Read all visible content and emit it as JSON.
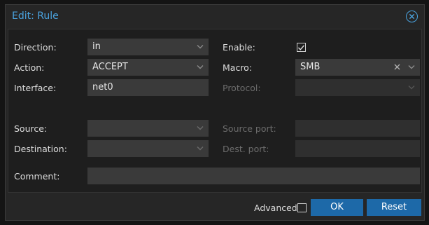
{
  "dialog": {
    "title": "Edit: Rule",
    "close_icon": "close-circle-icon"
  },
  "form": {
    "direction": {
      "label": "Direction:",
      "value": "in"
    },
    "action": {
      "label": "Action:",
      "value": "ACCEPT"
    },
    "interface": {
      "label": "Interface:",
      "value": "net0"
    },
    "enable": {
      "label": "Enable:",
      "checked": true
    },
    "macro": {
      "label": "Macro:",
      "value": "SMB"
    },
    "protocol": {
      "label": "Protocol:",
      "value": ""
    },
    "source": {
      "label": "Source:",
      "value": ""
    },
    "destination": {
      "label": "Destination:",
      "value": ""
    },
    "source_port": {
      "label": "Source port:",
      "value": ""
    },
    "dest_port": {
      "label": "Dest. port:",
      "value": ""
    },
    "comment": {
      "label": "Comment:",
      "value": ""
    }
  },
  "footer": {
    "advanced_label": "Advanced",
    "advanced_checked": false,
    "ok_label": "OK",
    "reset_label": "Reset"
  },
  "colors": {
    "accent": "#4aa3df",
    "button": "#1d69a8"
  }
}
